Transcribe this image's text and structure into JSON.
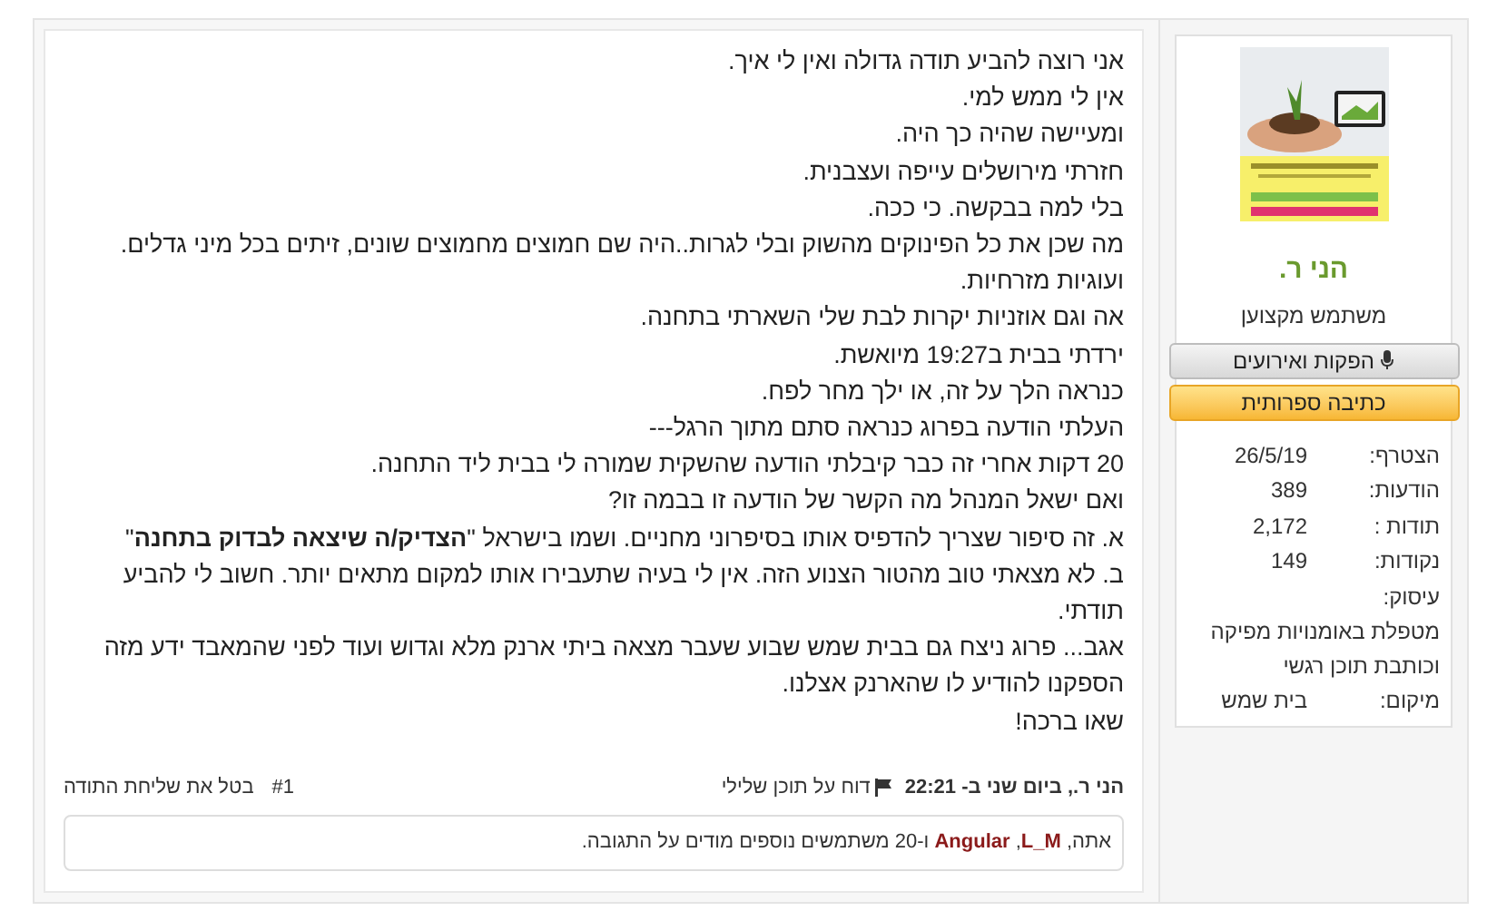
{
  "message": {
    "lines": [
      "אני רוצה להביע תודה גדולה ואין לי איך.",
      "אין לי ממש למי.",
      "ומעיישה שהיה כך היה.",
      "חזרתי מירושלים עייפה ועצבנית.",
      "בלי למה בבקשה. כי ככה.",
      "מה שכן את כל הפינוקים מהשוק ובלי לגרות..היה שם חמוצים מחמוצים שונים, זיתים בכל מיני גדלים.",
      "ועוגיות מזרחיות.",
      "אה וגם אוזניות יקרות לבת שלי השארתי בתחנה.",
      "ירדתי בבית ב19:27 מיואשת.",
      "כנראה הלך על זה, או ילך מחר לפח.",
      "העלתי הודעה בפרוג כנראה סתם מתוך הרגל---",
      "20 דקות אחרי זה כבר קיבלתי הודעה שהשקית שמורה לי בבית ליד התחנה.",
      "ואם ישאל המנהל מה הקשר של הודעה זו בבמה זו?",
      "א. זה סיפור שצריך להדפיס אותו בסיפרוני מחניים. ושמו בישראל \"**הצדיק/ה שיצאה לבדוק בתחנה**\"",
      "ב. לא מצאתי טוב מהטור הצנוע הזה. אין לי בעיה שתעבירו אותו למקום מתאים יותר. חשוב לי להביע",
      "תודתי.",
      "אגב... פרוג ניצח גם בבית שמש שבוע שעבר מצאה ביתי ארנק מלא וגדוש ועוד לפני שהמאבד ידע מזה",
      "הספקנו להודיע לו שהארנק אצלנו.",
      "שאו ברכה!"
    ],
    "byline": "הני ר., ביום שני ב- 22:21",
    "report": "דוח על תוכן שלילי",
    "number": "#1",
    "undo": "בטל את שליחת התודה",
    "likes": [
      {
        "kind": "text",
        "text": "אתה, "
      },
      {
        "kind": "user",
        "text": "L_M"
      },
      {
        "kind": "text",
        "text": ", "
      },
      {
        "kind": "user",
        "text": "Angular"
      },
      {
        "kind": "text",
        "text": " ו-20 משתמשים נוספים מודים על התגובה."
      }
    ]
  },
  "user": {
    "name": "הני ר.",
    "title": "משתמש מקצוען",
    "badge": "הפקות ואירועים",
    "banner": "כתיבה ספרותית",
    "stats": [
      {
        "kind": "pair",
        "label": "הצטרף:",
        "value": "26/5/19"
      },
      {
        "kind": "pair",
        "label": "הודעות:",
        "value": "389"
      },
      {
        "kind": "pair",
        "label": "תודות :",
        "value": "2,172"
      },
      {
        "kind": "pair",
        "label": "נקודות:",
        "value": "149"
      },
      {
        "kind": "wide",
        "label": "עיסוק:",
        "value": "מטפלת באומנויות מפיקה וכותבת תוכן רגשי"
      },
      {
        "kind": "pair",
        "label": "מיקום:",
        "value": "בית שמש"
      }
    ]
  }
}
